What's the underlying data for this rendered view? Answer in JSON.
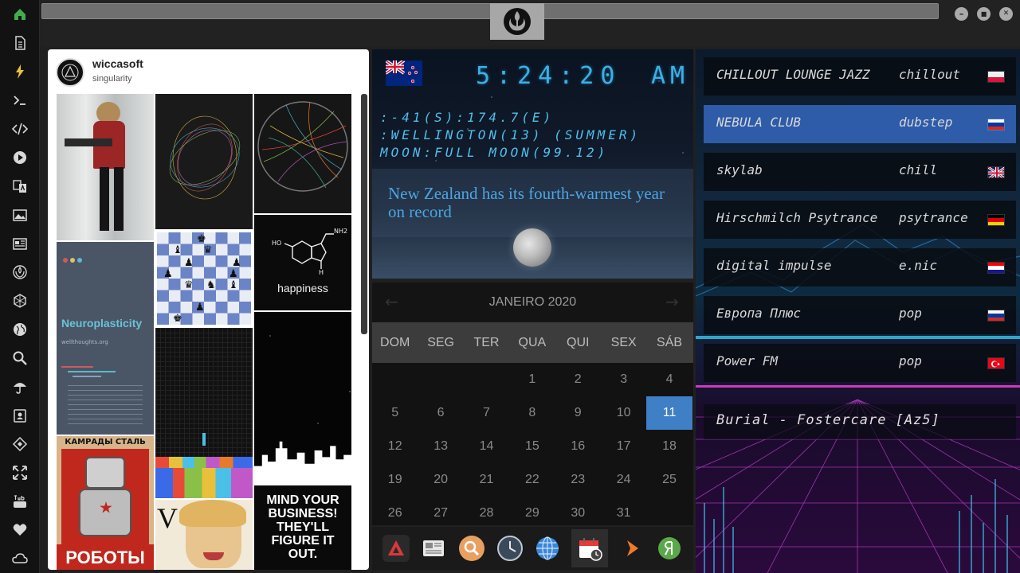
{
  "window": {
    "minimize_symbol": "–",
    "maximize_symbol": "■",
    "close_symbol": "✕"
  },
  "sidebar": {
    "items": [
      {
        "name": "home",
        "icon": "home-icon"
      },
      {
        "name": "document",
        "icon": "document-icon"
      },
      {
        "name": "lightning",
        "icon": "lightning-icon"
      },
      {
        "name": "terminal",
        "icon": "terminal-icon"
      },
      {
        "name": "code",
        "icon": "code-icon"
      },
      {
        "name": "play",
        "icon": "play-icon"
      },
      {
        "name": "translate",
        "icon": "translate-icon"
      },
      {
        "name": "image",
        "icon": "image-icon"
      },
      {
        "name": "news",
        "icon": "newspaper-icon"
      },
      {
        "name": "rebel",
        "icon": "rebel-alliance-icon"
      },
      {
        "name": "hexagon",
        "icon": "hexagon-icon"
      },
      {
        "name": "globe",
        "icon": "globe-icon"
      },
      {
        "name": "search",
        "icon": "search-icon"
      },
      {
        "name": "umbrella",
        "icon": "umbrella-icon"
      },
      {
        "name": "contacts",
        "icon": "contact-card-icon"
      },
      {
        "name": "codepen",
        "icon": "diamond-code-icon"
      },
      {
        "name": "expand",
        "icon": "expand-icon"
      },
      {
        "name": "youtube",
        "icon": "youtube-icon"
      },
      {
        "name": "heart",
        "icon": "heart-icon"
      },
      {
        "name": "cloud",
        "icon": "cloud-icon"
      }
    ]
  },
  "social": {
    "username": "wiccasoft",
    "subtitle": "singularity",
    "tiles": {
      "neuroplasticity_title": "Neuroplasticity",
      "neuroplasticity_site": "wellthoughts.org",
      "happiness": "happiness",
      "molecule_nh2": "NH2",
      "molecule_ho": "HO",
      "molecule_h": "H",
      "poster_header": "КАМРАДЫ СТАЛЬ",
      "poster_footer": "РОБОТЫ",
      "motto": "MIND YOUR BUSINESS! THEY'LL FIGURE IT OUT."
    }
  },
  "clock": {
    "time": "5:24:20",
    "ampm": "AM",
    "coords": ":-41(S):174.7(E)",
    "city": ":WELLINGTON(13) (SUMMER)",
    "moon": "MOON:FULL MOON(99.12)",
    "news": "New Zealand has its fourth-warmest year on record"
  },
  "calendar": {
    "title": "JANEIRO 2020",
    "prev": "←",
    "next": "→",
    "weekdays": [
      "DOM",
      "SEG",
      "TER",
      "QUA",
      "QUI",
      "SEX",
      "SÁB"
    ],
    "weeks": [
      [
        "",
        "",
        "",
        "1",
        "2",
        "3",
        "4"
      ],
      [
        "5",
        "6",
        "7",
        "8",
        "9",
        "10",
        "11"
      ],
      [
        "12",
        "13",
        "14",
        "15",
        "16",
        "17",
        "18"
      ],
      [
        "19",
        "20",
        "21",
        "22",
        "23",
        "24",
        "25"
      ],
      [
        "26",
        "27",
        "28",
        "29",
        "30",
        "31",
        ""
      ]
    ],
    "today": "11"
  },
  "dock": {
    "items": [
      "app-launcher-icon",
      "news-reader-icon",
      "search-icon",
      "clock-icon",
      "globe-icon",
      "calendar-icon",
      "arrow-icon",
      "yandex-icon"
    ]
  },
  "radio": {
    "stations": [
      {
        "name": "CHILLOUT LOUNGE JAZZ",
        "genre": "chillout",
        "flag": "poland-flag-icon"
      },
      {
        "name": "NEBULA CLUB",
        "genre": "dubstep",
        "flag": "russia-flag-icon",
        "selected": true
      },
      {
        "name": "skylab",
        "genre": "chill",
        "flag": "uk-flag-icon"
      },
      {
        "name": "Hirschmilch Psytrance",
        "genre": "psytrance",
        "flag": "germany-flag-icon"
      },
      {
        "name": "digital impulse",
        "genre": "e.nic",
        "flag": "croatia-flag-icon"
      },
      {
        "name": "Европа Плюс",
        "genre": "pop",
        "flag": "russia-flag-icon"
      },
      {
        "name": "Power FM",
        "genre": "pop",
        "flag": "turkey-flag-icon"
      }
    ],
    "now_playing": "Burial - Fostercare [Az5]"
  },
  "colors": {
    "accent": "#3f7fc6",
    "digital": "#3cb0e6",
    "sidebar_home": "#3fae49",
    "sidebar_lightning": "#e8c23a"
  }
}
